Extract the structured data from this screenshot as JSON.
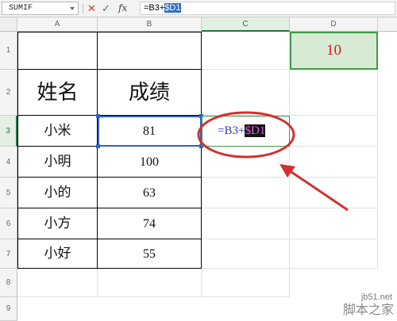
{
  "formula_bar": {
    "name_box": "SUMIF",
    "cancel_icon": "x-icon",
    "confirm_icon": "check-icon",
    "function_icon": "fx-icon",
    "formula_prefix": "=B3+",
    "formula_ref": "$D1"
  },
  "columns": [
    "A",
    "B",
    "C",
    "D"
  ],
  "rows": [
    "1",
    "2",
    "3",
    "4",
    "5",
    "6",
    "7",
    "8",
    "9"
  ],
  "table": {
    "header_name": "姓名",
    "header_score": "成绩",
    "entries": [
      {
        "name": "小米",
        "score": "81"
      },
      {
        "name": "小明",
        "score": "100"
      },
      {
        "name": "小的",
        "score": "63"
      },
      {
        "name": "小方",
        "score": "74"
      },
      {
        "name": "小好",
        "score": "55"
      }
    ]
  },
  "d1_value": "10",
  "c3_formula": {
    "prefix": "=B3+",
    "ref": "$D1"
  },
  "watermark": {
    "site": "jb51.net",
    "brand": "脚本之家"
  },
  "colors": {
    "annotation_red": "#d32f2f",
    "selection_green": "#217346",
    "reference_blue": "#2f62c8",
    "d1_fill": "#d7ead3"
  }
}
